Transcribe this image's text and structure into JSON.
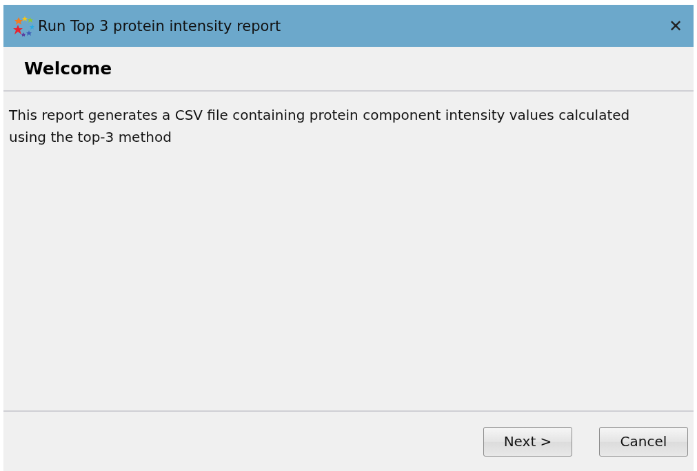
{
  "window": {
    "title": "Run Top 3 protein intensity report",
    "close": "✕"
  },
  "page": {
    "heading": "Welcome",
    "description": "This report generates a CSV file containing protein component intensity values calculated using the top-3 method"
  },
  "buttons": [
    {
      "label": "Next >"
    },
    {
      "label": "Cancel"
    }
  ]
}
